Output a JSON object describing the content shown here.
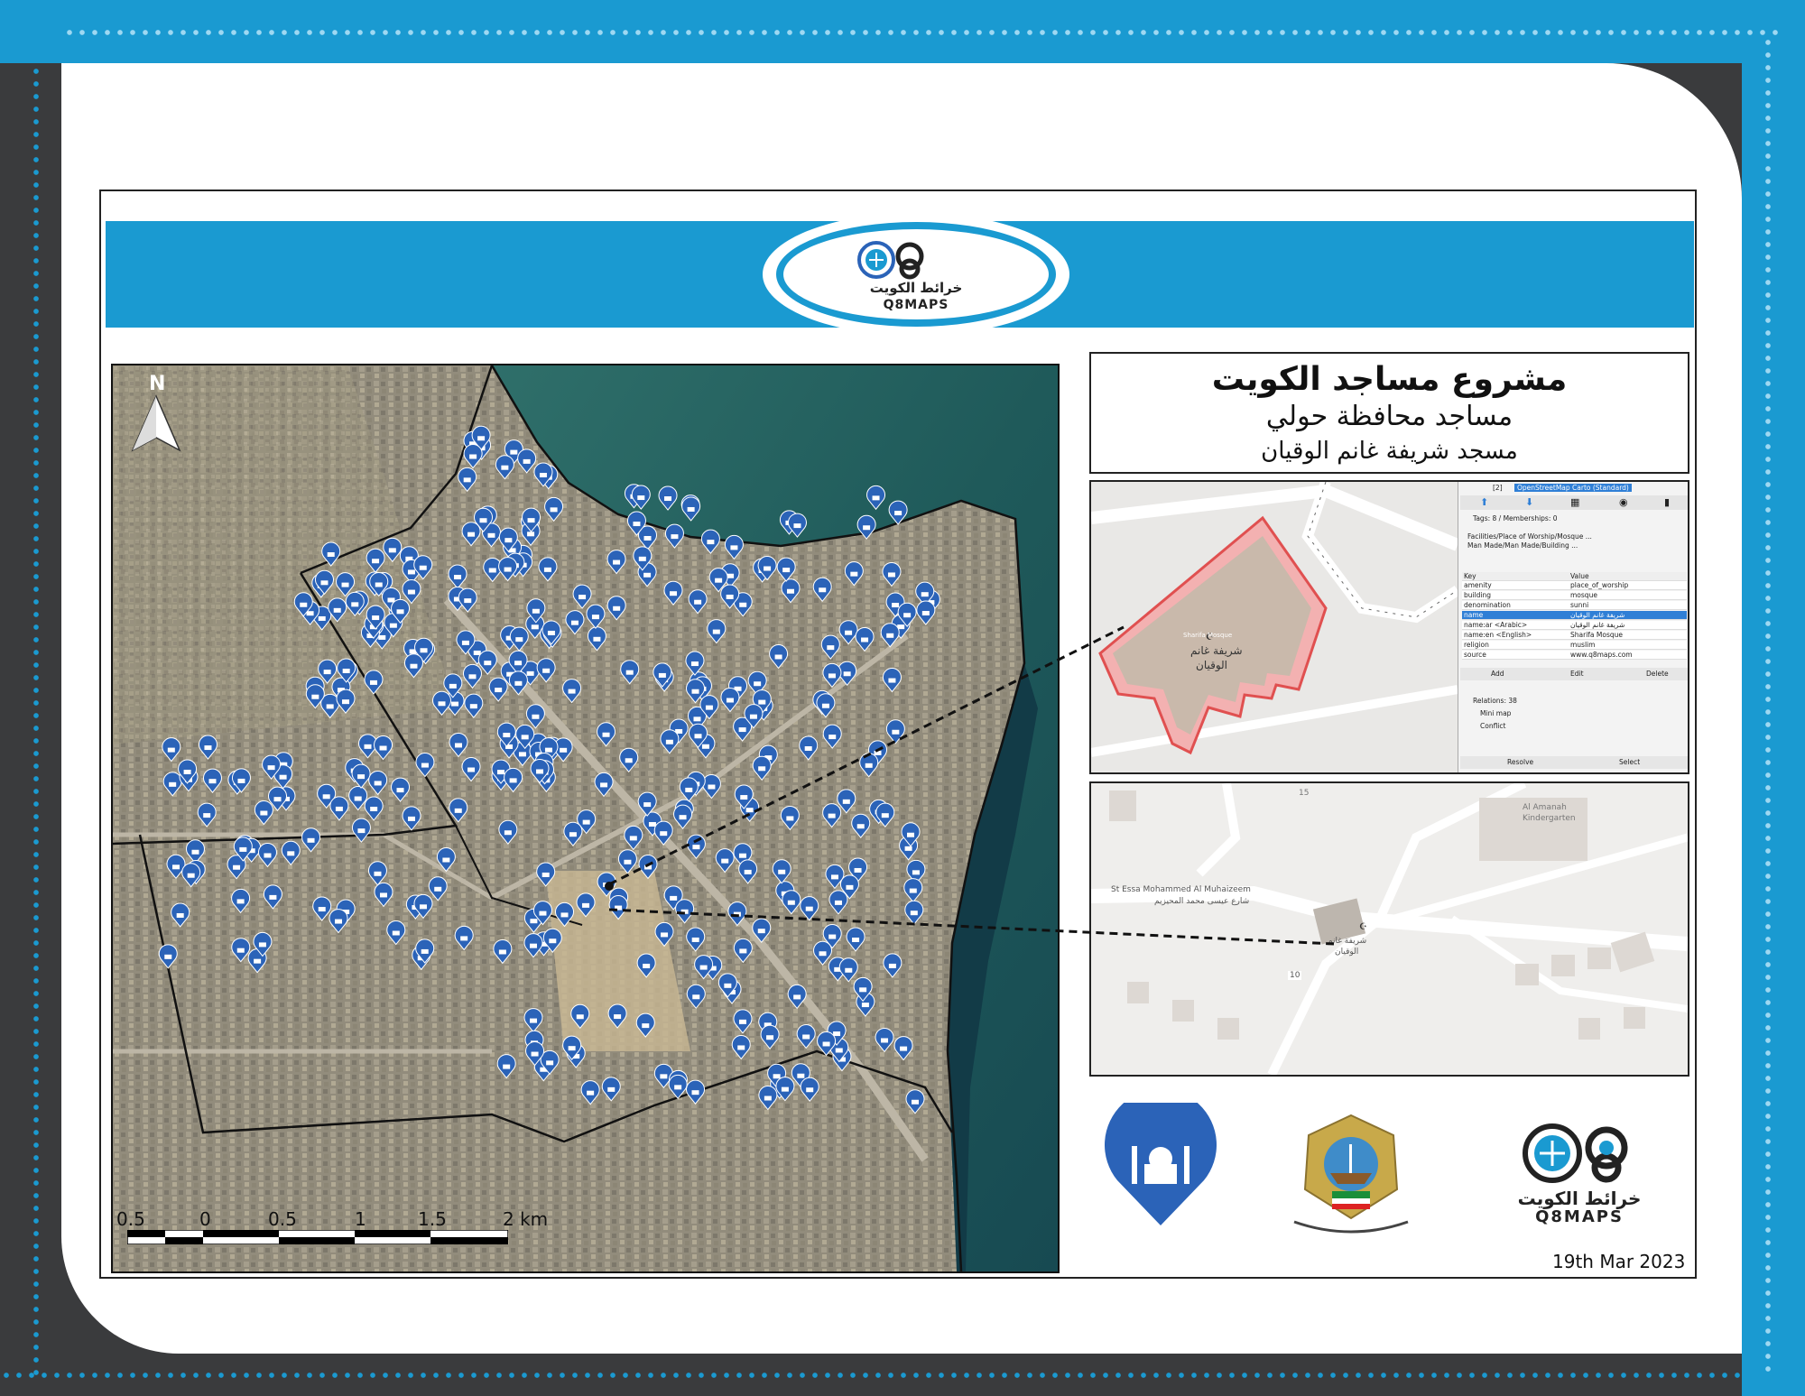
{
  "brand": {
    "name_ar": "خرائط الكويت",
    "name_en": "Q8MAPS",
    "logo_mark": "Q8"
  },
  "title": {
    "main": "مشروع مساجد الكويت",
    "subtitle": "مساجد محافظة حولي",
    "mosque_name": "مسجد شريفة غانم الوقيان"
  },
  "map": {
    "north_label": "N",
    "scale_labels": [
      "0.5",
      "0",
      "0.5",
      "1",
      "1.5",
      "2 km"
    ],
    "marker_icon": "mosque-pin-icon"
  },
  "osm_panel": {
    "layer_count": "[2]",
    "layer": "OpenStreetMap Carto (Standard)",
    "tags_header": "Tags: 8 / Memberships: 0",
    "preset1": "Facilities/Place of Worship/Mosque ...",
    "preset2": "Man Made/Man Made/Building ...",
    "col_key": "Key",
    "col_value": "Value",
    "tags": [
      {
        "key": "amenity",
        "value": "place_of_worship"
      },
      {
        "key": "building",
        "value": "mosque"
      },
      {
        "key": "denomination",
        "value": "sunni"
      },
      {
        "key": "name",
        "value": "شريفة غانم الوقيان"
      },
      {
        "key": "name:ar  <Arabic>",
        "value": "شريفة غانم الوقيان"
      },
      {
        "key": "name:en  <English>",
        "value": "Sharifa Mosque"
      },
      {
        "key": "religion",
        "value": "muslim"
      },
      {
        "key": "source",
        "value": "www.q8maps.com"
      }
    ],
    "btn_add": "Add",
    "btn_edit": "Edit",
    "btn_delete": "Delete",
    "relations": "Relations: 38",
    "minimap": "Mini map",
    "conflict": "Conflict",
    "btn_resolve": "Resolve",
    "btn_select": "Select",
    "building_label_en": "Sharifa Mosque",
    "building_label_ar1": "شريفة غانم",
    "building_label_ar2": "الوقيان"
  },
  "street_map": {
    "school": "Al Amanah",
    "school2": "Kindergarten",
    "street_ar": "شارع عيسى محمد المحيزيم",
    "street_en": "St Essa Mohammed Al Muhaizeem",
    "road_no": "10",
    "plot_no": "15",
    "mosque_ar1": "شريفة غانم",
    "mosque_ar2": "الوقيان"
  },
  "footer": {
    "date": "19th Mar 2023"
  },
  "colors": {
    "frame_blue": "#1a9ad1",
    "frame_dark": "#3a3b3d",
    "pin_blue": "#2b63b8",
    "building_red": "#e05050"
  }
}
